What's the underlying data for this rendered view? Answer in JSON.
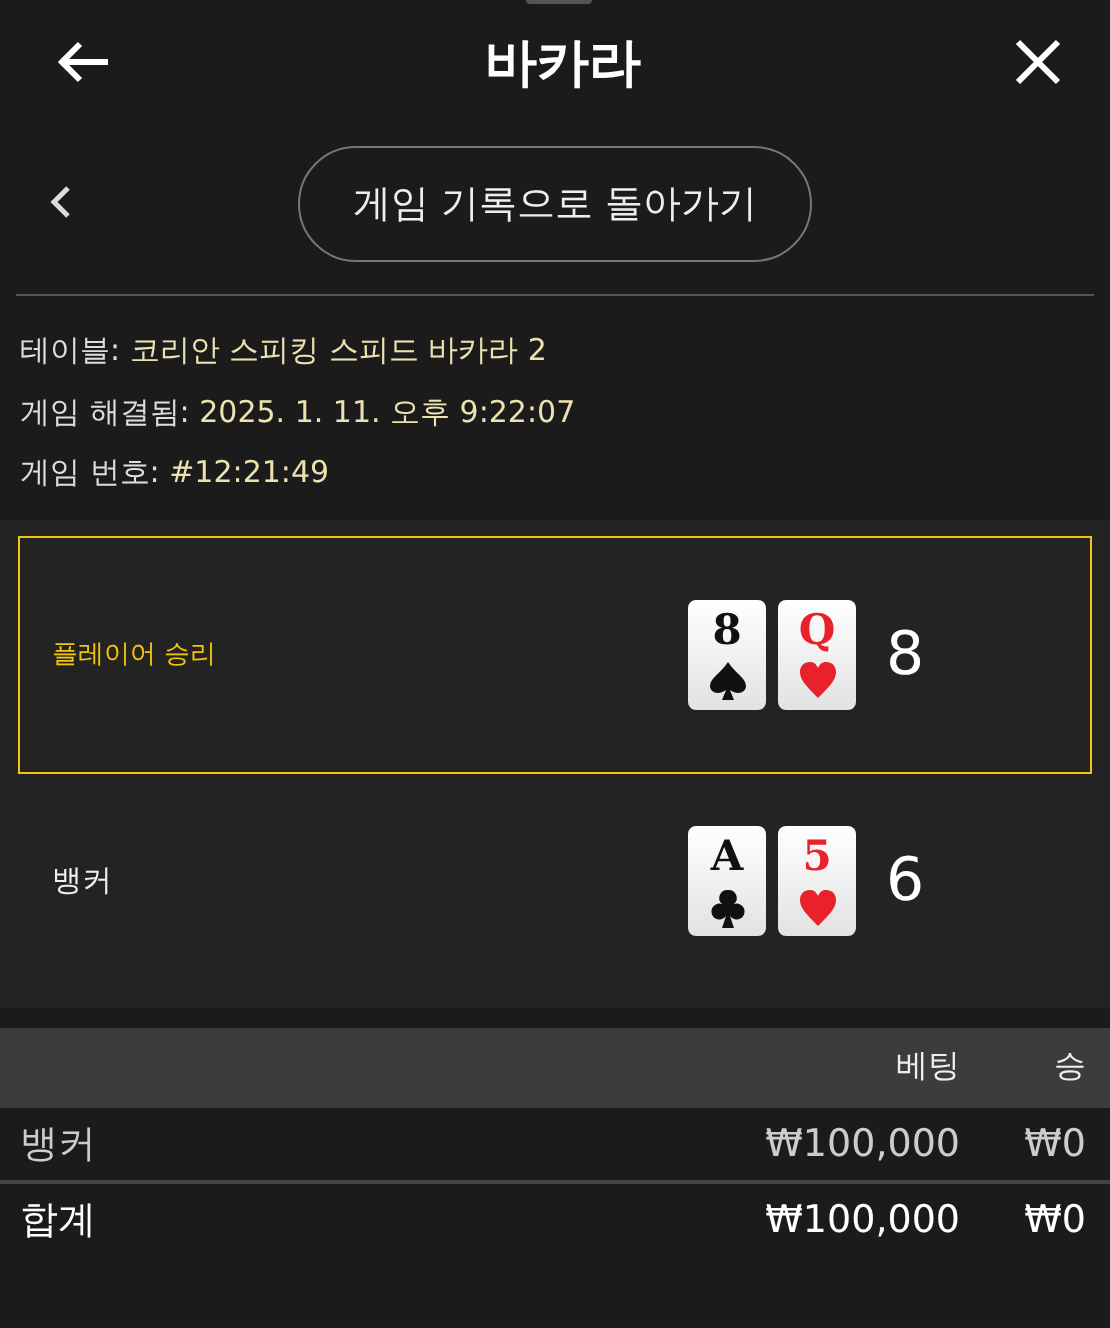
{
  "header": {
    "title": "바카라"
  },
  "back_button": {
    "label": "게임 기록으로 돌아가기"
  },
  "info": [
    {
      "label": "테이블:",
      "value": "코리안 스피킹 스피드 바카라 2"
    },
    {
      "label": "게임 해결됨:",
      "value": "2025. 1. 11. 오후 9:22:07"
    },
    {
      "label": "게임 번호:",
      "value": "#12:21:49"
    }
  ],
  "hands": [
    {
      "label": "플레이어 승리",
      "winner": true,
      "cards": [
        {
          "rank": "8",
          "kind": "spade"
        },
        {
          "rank": "Q",
          "kind": "heart"
        }
      ],
      "total": "8"
    },
    {
      "label": "뱅커",
      "winner": false,
      "cards": [
        {
          "rank": "A",
          "kind": "club"
        },
        {
          "rank": "5",
          "kind": "heart"
        }
      ],
      "total": "6"
    }
  ],
  "bets": {
    "columns": [
      "",
      "베팅",
      "승"
    ],
    "rows": [
      {
        "kind": "bet",
        "cells": [
          "뱅커",
          "₩100,000",
          "₩0"
        ]
      },
      {
        "kind": "total",
        "cells": [
          "합계",
          "₩100,000",
          "₩0"
        ]
      }
    ]
  }
}
